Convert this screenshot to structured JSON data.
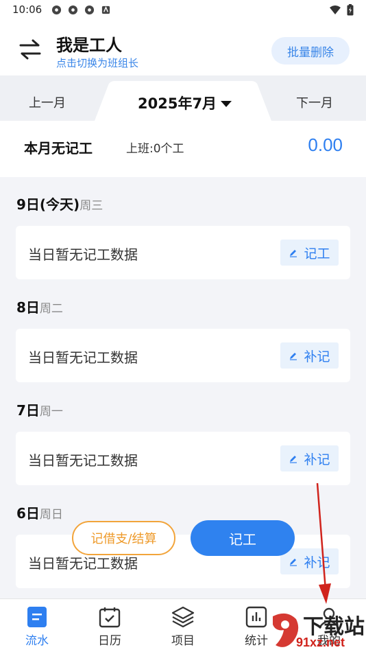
{
  "status_bar": {
    "time": "10:06"
  },
  "header": {
    "role_title": "我是工人",
    "role_subtitle": "点击切换为班组长",
    "batch_delete_label": "批量删除"
  },
  "month_bar": {
    "prev_label": "上一月",
    "current_label": "2025年7月",
    "next_label": "下一月"
  },
  "summary": {
    "title": "本月无记工",
    "work_label": "上班:0个工",
    "amount": "0.00"
  },
  "days": [
    {
      "day": "9日(今天)",
      "weekday": "周三",
      "empty_text": "当日暂无记工数据",
      "action_label": "记工"
    },
    {
      "day": "8日",
      "weekday": "周二",
      "empty_text": "当日暂无记工数据",
      "action_label": "补记"
    },
    {
      "day": "7日",
      "weekday": "周一",
      "empty_text": "当日暂无记工数据",
      "action_label": "补记"
    },
    {
      "day": "6日",
      "weekday": "周日",
      "empty_text": "当日暂无记工数据",
      "action_label": "补记"
    }
  ],
  "floating": {
    "loan_label": "记借支/结算",
    "record_label": "记工"
  },
  "bottom_nav": [
    {
      "label": "流水",
      "icon": "document-icon",
      "active": true
    },
    {
      "label": "日历",
      "icon": "calendar-icon",
      "active": false
    },
    {
      "label": "项目",
      "icon": "layers-icon",
      "active": false
    },
    {
      "label": "统计",
      "icon": "chart-icon",
      "active": false
    },
    {
      "label": "我的",
      "icon": "profile-icon",
      "active": false
    }
  ],
  "watermark": {
    "text": "下载站",
    "sub": "91xz.net"
  },
  "colors": {
    "accent": "#2e7ff0",
    "loan": "#ee9a2a",
    "arrow": "#d0231c"
  }
}
